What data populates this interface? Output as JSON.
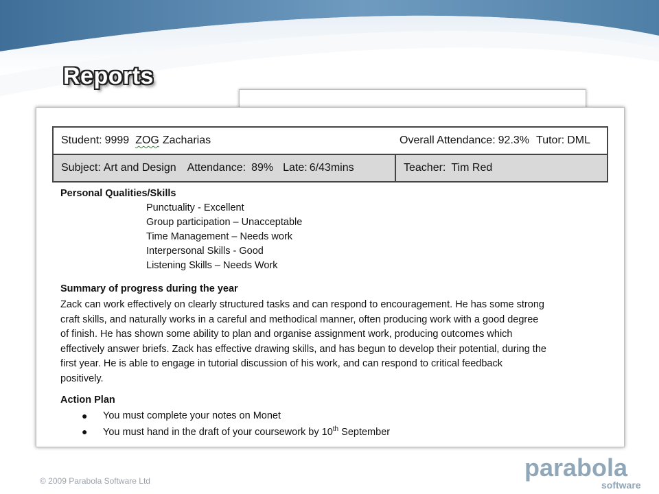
{
  "slide": {
    "title": "Reports",
    "footer": "© 2009 Parabola Software Ltd",
    "logo": {
      "word": "parabola",
      "sub": "software"
    }
  },
  "report": {
    "header": {
      "student_label": "Student:",
      "student_id": "9999",
      "student_code": "ZOG",
      "student_name": "Zacharias",
      "overall_attendance_label": "Overall Attendance:",
      "overall_attendance_value": "92.3%",
      "tutor_label": "Tutor:",
      "tutor_value": "DML",
      "subject_label": "Subject:",
      "subject_value": "Art and Design",
      "attendance_label": "Attendance:",
      "attendance_value": "89%",
      "late_label": "Late:",
      "late_value": "6/43mins",
      "teacher_label": "Teacher:",
      "teacher_value": "Tim Red"
    },
    "qualities": {
      "heading": "Personal Qualities/Skills",
      "items": [
        "Punctuality - Excellent",
        "Group participation – Unacceptable",
        "Time Management – Needs work",
        "Interpersonal Skills - Good",
        "Listening Skills – Needs Work"
      ]
    },
    "summary": {
      "heading": "Summary of progress during the year",
      "lines": [
        "Zack can work effectively on clearly structured tasks and can respond to encouragement. He has some strong",
        "craft skills, and naturally works in a careful and methodical manner, often producing work with a good degree",
        "of finish.  He has shown some ability to plan and organise assignment work, producing outcomes which",
        "effectively answer briefs. Zack has effective drawing skills, and has begun to develop their potential, during the",
        "first year. He is able to engage in tutorial discussion of his work, and can respond to critical feedback",
        "positively."
      ]
    },
    "action_plan": {
      "heading": "Action Plan",
      "bullet_1": "You must complete your notes on Monet",
      "bullet_2_pre": "You must hand in the draft of your coursework by 10",
      "bullet_2_sup": "th",
      "bullet_2_post": " September"
    }
  },
  "colors": {
    "swoosh_dark": "#4f7fa6",
    "swoosh_light": "#cfe0ee",
    "logo": "#8fa7b8",
    "footer_text": "#9aa3ab",
    "row_shade": "#d9d9d9"
  }
}
